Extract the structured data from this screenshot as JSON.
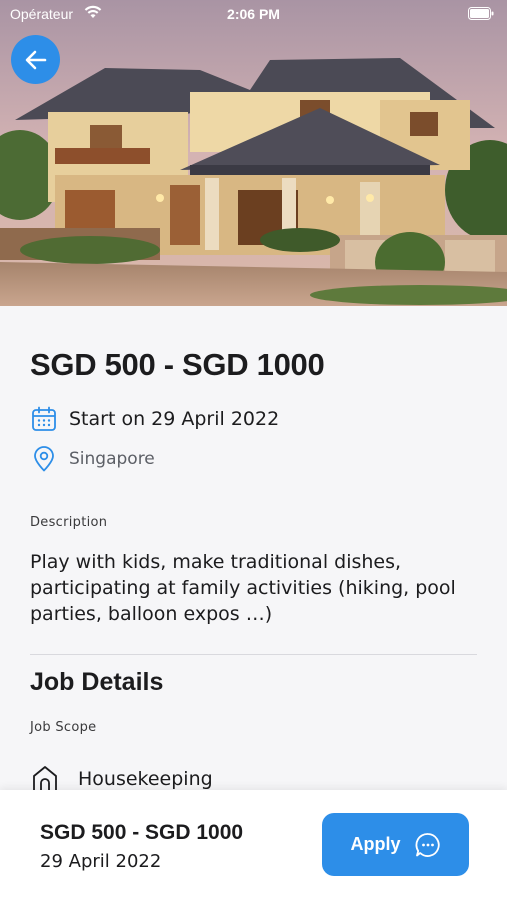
{
  "status_bar": {
    "carrier": "Opérateur",
    "time": "2:06 PM"
  },
  "hero": {
    "image": "villa-house-photo",
    "alt": "Two-storey villa house"
  },
  "job": {
    "price_range": "SGD 500 - SGD 1000",
    "start_date": "Start on 29 April 2022",
    "location": "Singapore",
    "description_label": "Description",
    "description": "Play with kids, make traditional dishes, participating at family activities (hiking, pool parties, balloon expos …)"
  },
  "details": {
    "title": "Job Details",
    "scope_label": "Job Scope",
    "scope_items": [
      "Housekeeping"
    ]
  },
  "bottom_bar": {
    "price_range": "SGD 500 - SGD 1000",
    "date": "29 April 2022",
    "apply_label": "Apply"
  },
  "colors": {
    "accent": "#2d8ee8",
    "background": "#f6f6f8",
    "text": "#1c1c1e",
    "muted": "#5c5f66"
  },
  "icons": {
    "back": "arrow-left-icon",
    "calendar": "calendar-icon",
    "location": "map-pin-icon",
    "scope": "house-icon",
    "apply": "chat-bubble-icon",
    "wifi": "wifi-icon",
    "battery": "battery-icon"
  }
}
